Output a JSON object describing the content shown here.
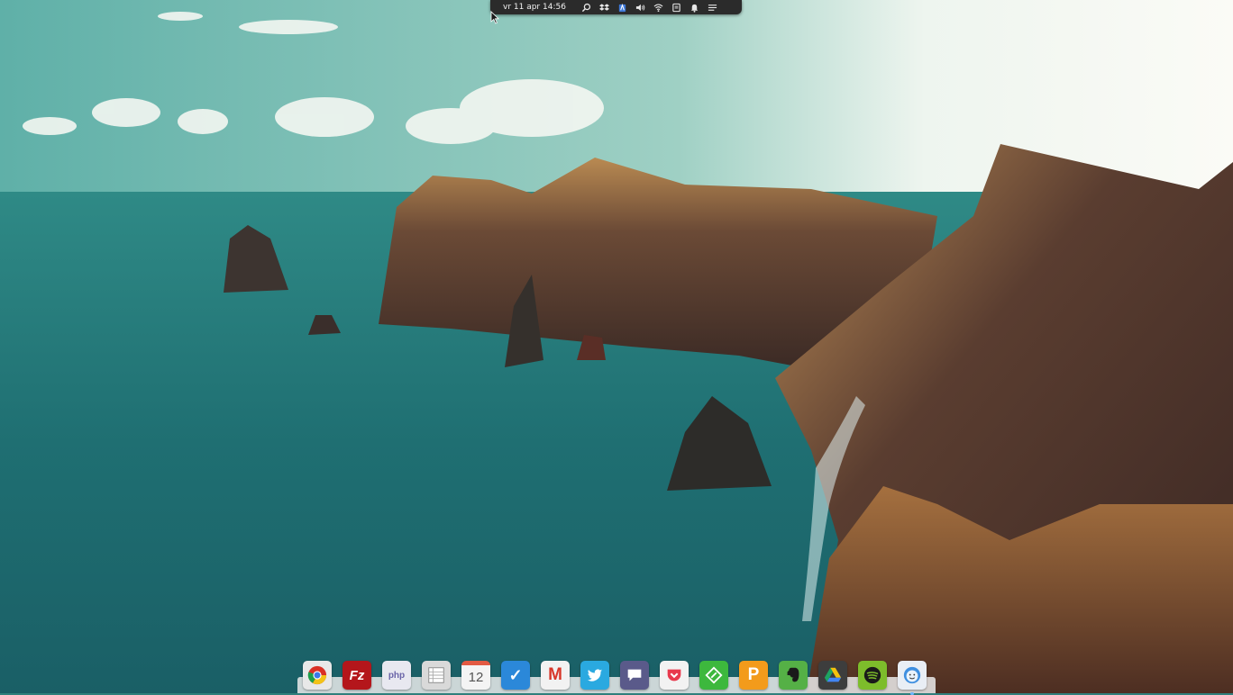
{
  "panel": {
    "clock": "vr 11 apr 14:56",
    "indicators": [
      "search-icon",
      "dropbox-icon",
      "accessibility-icon",
      "volume-icon",
      "wifi-icon",
      "clipboard-icon",
      "bell-icon",
      "session-menu-icon"
    ]
  },
  "dock": {
    "apps": [
      {
        "name": "chrome",
        "icon": "chrome-icon",
        "color": "#e8e8e8"
      },
      {
        "name": "filezilla",
        "icon": "filezilla-icon",
        "label": "Fz",
        "color": "#b4161b"
      },
      {
        "name": "phpstorm",
        "icon": "php-icon",
        "label": "php",
        "color": "#e8e8f0"
      },
      {
        "name": "spreadsheet",
        "icon": "spreadsheet-icon",
        "color": "#d9d9d9"
      },
      {
        "name": "calendar",
        "icon": "calendar-icon",
        "label": "12",
        "color": "#f4f4f4"
      },
      {
        "name": "wunderlist",
        "icon": "checkmark-icon",
        "label": "✓",
        "color": "#2b88d9"
      },
      {
        "name": "gmail",
        "icon": "gmail-icon",
        "label": "M",
        "color": "#f2f2f2"
      },
      {
        "name": "twitter",
        "icon": "twitter-bird-icon",
        "color": "#2aa9e0"
      },
      {
        "name": "messaging",
        "icon": "chat-bubble-icon",
        "color": "#5a5a8a"
      },
      {
        "name": "pocket",
        "icon": "pocket-icon",
        "color": "#f2f2f2"
      },
      {
        "name": "feedly",
        "icon": "feedly-icon",
        "color": "#3db83d"
      },
      {
        "name": "presentation",
        "icon": "presentation-icon",
        "label": "P",
        "color": "#f39b1b"
      },
      {
        "name": "evernote",
        "icon": "evernote-icon",
        "color": "#55b046"
      },
      {
        "name": "google-drive",
        "icon": "drive-icon",
        "color": "#3d3d3d"
      },
      {
        "name": "spotify",
        "icon": "spotify-icon",
        "color": "#7dbd2b"
      },
      {
        "name": "finder-face",
        "icon": "smiley-face-icon",
        "color": "#e9eef5"
      }
    ]
  }
}
